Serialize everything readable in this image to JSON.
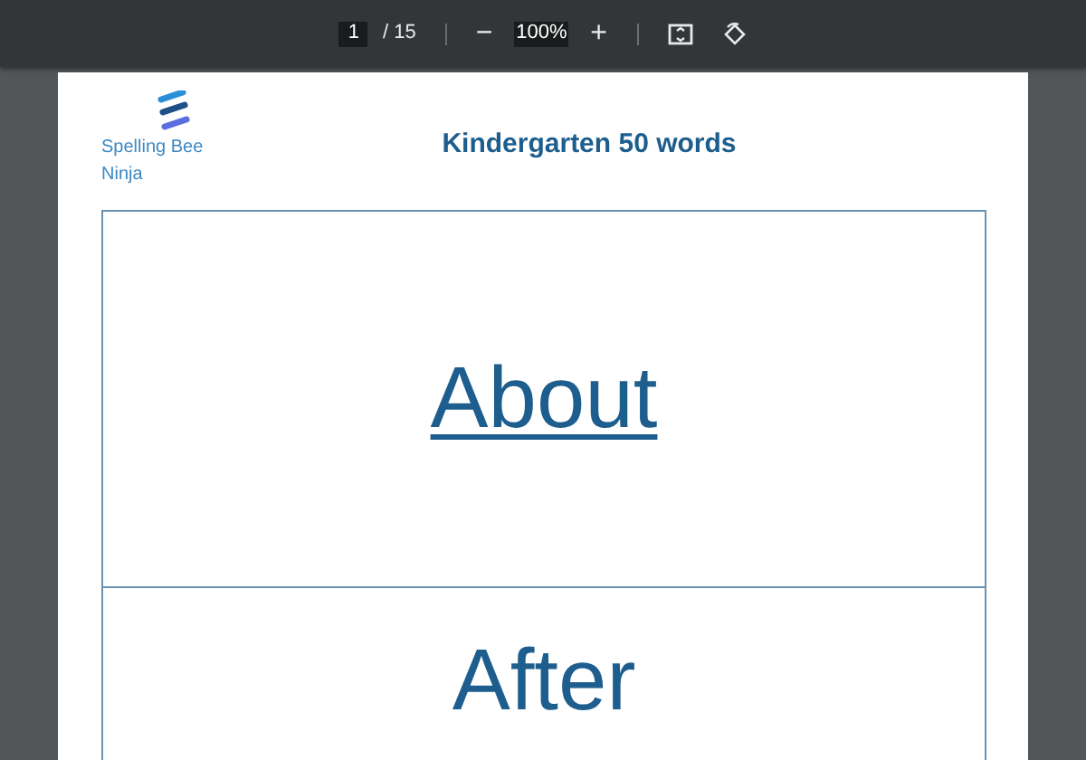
{
  "toolbar": {
    "page_number": "1",
    "page_count": "/ 15",
    "zoom_out": "−",
    "zoom": "100%",
    "zoom_in": "+"
  },
  "document": {
    "logo_text": "Spelling Bee Ninja",
    "title": "Kindergarten 50 words",
    "words": [
      "About",
      "After"
    ]
  }
}
